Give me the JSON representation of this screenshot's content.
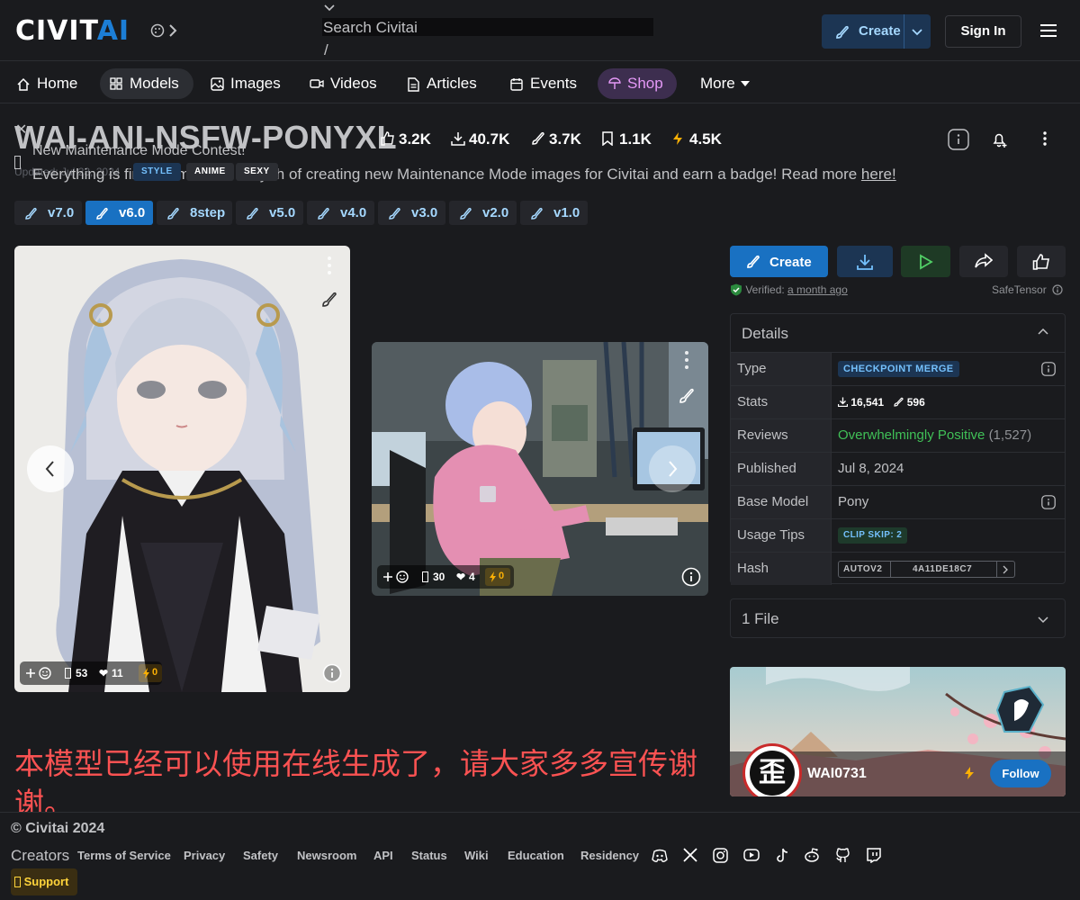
{
  "header": {
    "logo_left": "CIVIT",
    "logo_right": "AI",
    "search_placeholder": "Search Civitai",
    "search_shortcut": "/",
    "create_label": "Create",
    "signin_label": "Sign In"
  },
  "nav": {
    "items": [
      {
        "label": "Home",
        "icon": "home-icon"
      },
      {
        "label": "Models",
        "icon": "grid-icon",
        "active": true
      },
      {
        "label": "Images",
        "icon": "photo-icon"
      },
      {
        "label": "Videos",
        "icon": "video-icon"
      },
      {
        "label": "Articles",
        "icon": "file-text-icon"
      },
      {
        "label": "Events",
        "icon": "calendar-icon"
      },
      {
        "label": "Shop",
        "icon": "shirt-icon"
      },
      {
        "label": "More",
        "icon": "chevron-down-icon"
      }
    ]
  },
  "model": {
    "title": "WAI-ANI-NSFW-PONYXL",
    "stats": {
      "likes": "3.2K",
      "downloads": "40.7K",
      "generations": "3.7K",
      "bookmarks": "1.1K",
      "buzz": "4.5K"
    },
    "updated": "Updated: Jul 23, 2024",
    "tags": [
      "STYLE",
      "ANIME",
      "SEXY"
    ]
  },
  "banner": {
    "title": "New Maintenance Mode Contest!",
    "text_prefix": "Everything is fine! Com",
    "text_middle": "y th",
    "text_suffix": "of creating new Maintenance Mode images for Civitai and earn a badge! Read more",
    "link": "here!"
  },
  "versions": [
    "v7.0",
    "v6.0",
    "8step",
    "v5.0",
    "v4.0",
    "v3.0",
    "v2.0",
    "v1.0"
  ],
  "active_version": "v6.0",
  "images": [
    {
      "comments": "53",
      "likes": "11",
      "buzz": "0"
    },
    {
      "comments": "30",
      "likes": "4",
      "buzz": "0"
    }
  ],
  "actions": {
    "create_label": "Create",
    "verified_label": "Verified:",
    "verified_when": "a month ago",
    "safetensor": "SafeTensor"
  },
  "details": {
    "title": "Details",
    "rows": {
      "type_key": "Type",
      "type_val": "CHECKPOINT MERGE",
      "stats_key": "Stats",
      "stats_downloads": "16,541",
      "stats_generations": "596",
      "reviews_key": "Reviews",
      "reviews_val": "Overwhelmingly Positive",
      "reviews_count": "(1,527)",
      "published_key": "Published",
      "published_val": "Jul 8, 2024",
      "base_key": "Base Model",
      "base_val": "Pony",
      "usage_key": "Usage Tips",
      "usage_val": "CLIP SKIP: 2",
      "hash_key": "Hash",
      "hash_type": "AUTOV2",
      "hash_val": "4A11DE18C7"
    }
  },
  "files": {
    "title": "1 File"
  },
  "creator": {
    "name": "WAI0731",
    "follow": "Follow",
    "avatar_char": "歪"
  },
  "description": "本模型已经可以使用在线生成了，请大家多多宣传谢谢。",
  "footer": {
    "copyright": "© Civitai 2024",
    "creators": "Creators",
    "links": [
      "Terms of Service",
      "Privacy",
      "Safety",
      "Newsroom",
      "API",
      "Status",
      "Wiki",
      "Education",
      "Residency"
    ],
    "support": "Support"
  },
  "colors": {
    "accent": "#1971c2",
    "shop": "#e599f7",
    "positive": "#40c057",
    "warning": "#fab005",
    "description": "#fa5252"
  }
}
